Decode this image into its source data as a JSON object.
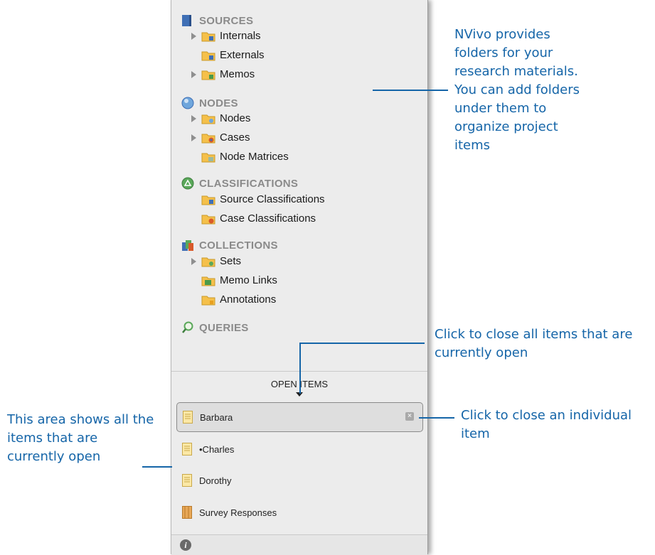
{
  "sidebar": {
    "sources": {
      "title": "SOURCES",
      "items": [
        {
          "label": "Internals",
          "expandable": true,
          "icon": "folder-internals-icon"
        },
        {
          "label": "Externals",
          "expandable": false,
          "icon": "folder-externals-icon"
        },
        {
          "label": "Memos",
          "expandable": true,
          "icon": "folder-memos-icon"
        }
      ]
    },
    "nodes": {
      "title": "NODES",
      "items": [
        {
          "label": "Nodes",
          "expandable": true
        },
        {
          "label": "Cases",
          "expandable": true
        },
        {
          "label": "Node Matrices",
          "expandable": false
        }
      ]
    },
    "classifications": {
      "title": "CLASSIFICATIONS",
      "items": [
        {
          "label": "Source Classifications"
        },
        {
          "label": "Case Classifications"
        }
      ]
    },
    "collections": {
      "title": "COLLECTIONS",
      "items": [
        {
          "label": "Sets",
          "expandable": true
        },
        {
          "label": "Memo Links"
        },
        {
          "label": "Annotations"
        }
      ]
    },
    "queries": {
      "title": "QUERIES"
    }
  },
  "open_items": {
    "header": "OPEN ITEMS",
    "items": [
      {
        "label": "Barbara",
        "selected": true
      },
      {
        "label": "•Charles"
      },
      {
        "label": "Dorothy"
      },
      {
        "label": "Survey Responses"
      }
    ]
  },
  "annotations": {
    "folders": "NVivo provides folders for your research materials. You can add folders under them to organize project items",
    "close_all": "Click to close all items that are currently open",
    "close_one": "Click to close an individual item",
    "open_area": "This area shows all the items that are currently open"
  },
  "colors": {
    "annotation": "#1565a8",
    "folder": "#f5c04a",
    "panel": "#ececec"
  }
}
